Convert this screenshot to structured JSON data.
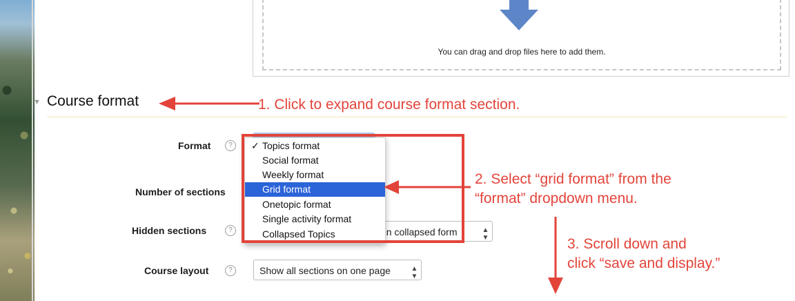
{
  "dropzone": {
    "text": "You can drag and drop files here to add them."
  },
  "section": {
    "title": "Course format"
  },
  "form": {
    "format": {
      "label": "Format",
      "help": "?",
      "options": [
        "Topics format",
        "Social format",
        "Weekly format",
        "Grid format",
        "Onetopic format",
        "Single activity format",
        "Collapsed Topics"
      ],
      "checked_mark": "✓",
      "checked_option": "Topics format",
      "highlighted_option": "Grid format"
    },
    "number_of_sections": {
      "label": "Number of sections"
    },
    "hidden_sections": {
      "label": "Hidden sections",
      "help": "?",
      "visible_value": "n in collapsed form"
    },
    "course_layout": {
      "label": "Course layout",
      "help": "?",
      "value": "Show all sections on one page"
    },
    "select_arrows": "▲▼"
  },
  "annotations": {
    "step1": "1. Click to expand course format section.",
    "step2_line1": "2. Select “grid format” from the",
    "step2_line2": "“format” dropdown menu.",
    "step3_line1": "3. Scroll down and",
    "step3_line2": "click “save and display.”"
  },
  "colors": {
    "annotation_red": "#e2443a",
    "highlight_blue": "#2b63d8",
    "drop_arrow_blue": "#5d86c9"
  }
}
